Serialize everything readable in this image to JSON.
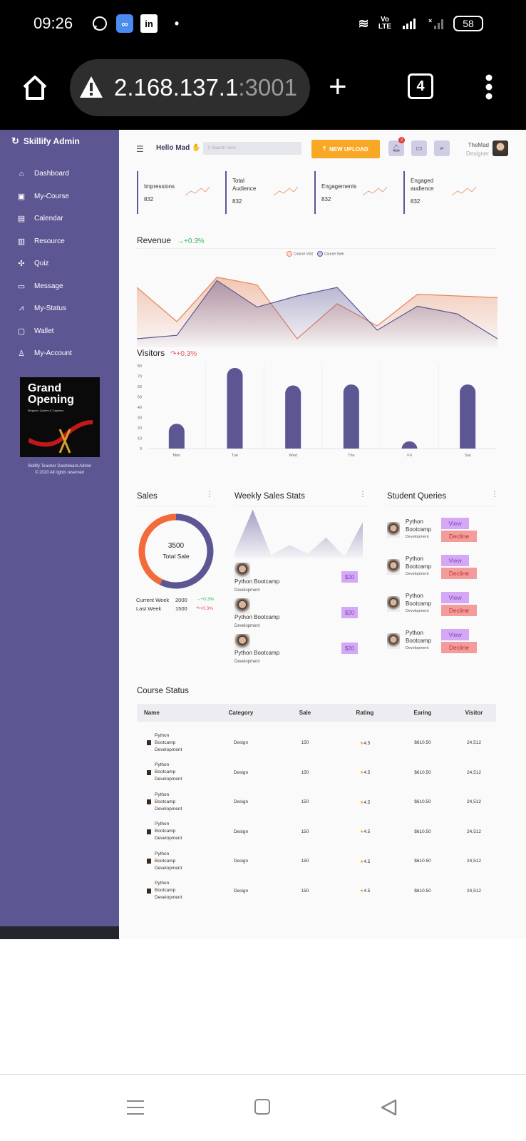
{
  "status_bar": {
    "time": "09:26",
    "battery": "58",
    "network": "Vo LTE",
    "icons": [
      "whatsapp-icon",
      "infinity-app-icon",
      "linkedin-icon",
      "dot-icon",
      "wifi-icon",
      "signal-icon",
      "signal-x-icon",
      "battery-icon"
    ]
  },
  "browser": {
    "url_host": "2.168.137.1",
    "url_port": ":3001",
    "tabs_count": "4",
    "icons": [
      "home-icon",
      "warning-icon",
      "plus-icon",
      "tabs-icon",
      "more-icon"
    ]
  },
  "sidebar": {
    "brand": "Skillify Admin",
    "items": [
      {
        "label": "Dashboard",
        "icon": "home-icon"
      },
      {
        "label": "My-Course",
        "icon": "play-box-icon"
      },
      {
        "label": "Calendar",
        "icon": "calendar-icon"
      },
      {
        "label": "Resource",
        "icon": "book-icon"
      },
      {
        "label": "Quiz",
        "icon": "puzzle-icon"
      },
      {
        "label": "Message",
        "icon": "message-icon"
      },
      {
        "label": "My-Status",
        "icon": "trend-icon"
      },
      {
        "label": "Wallet",
        "icon": "wallet-icon"
      },
      {
        "label": "My-Account",
        "icon": "user-icon"
      }
    ],
    "promo": {
      "title_line1": "Grand",
      "title_line2": "Opening",
      "subtitle": "Blogues, Quotes & Captions"
    },
    "copyright_line1": "Skillify Teacher Dashboard Admin",
    "copyright_line2": "© 2020 All rights reserved"
  },
  "header": {
    "greeting": "Hello Mad ✋",
    "search_placeholder": "Search Here",
    "upload_label": "NEW UPLOAD",
    "notification_count": "2",
    "user_name": "TheMad",
    "user_role": "Designer"
  },
  "stats": [
    {
      "label": "Impressions",
      "value": "832"
    },
    {
      "label": "Total Audience",
      "value": "832"
    },
    {
      "label": "Engagements",
      "value": "832"
    },
    {
      "label": "Engaged audience",
      "value": "832"
    }
  ],
  "revenue": {
    "title": "Revenue",
    "delta": "+0.3%",
    "legend": [
      "Course Visit",
      "Course Sale"
    ]
  },
  "visitors": {
    "title": "Visitors",
    "delta": "+0.3%"
  },
  "chart_data": [
    {
      "type": "area",
      "title": "Revenue",
      "legend_position": "top",
      "series": [
        {
          "name": "Course Visit",
          "color": "#e8855a",
          "values": [
            70,
            30,
            82,
            73,
            10,
            51,
            25,
            62,
            60,
            58
          ]
        },
        {
          "name": "Course Sale",
          "color": "#5c5693",
          "values": [
            10,
            14,
            78,
            47,
            60,
            70,
            20,
            48,
            39,
            10
          ]
        }
      ]
    },
    {
      "type": "bar",
      "title": "Visitors",
      "categories": [
        "Mon",
        "Tue",
        "Wed",
        "Thu",
        "Fri",
        "Sat"
      ],
      "values": [
        24,
        78,
        61,
        62,
        7,
        62
      ],
      "yticks": [
        0,
        10,
        20,
        30,
        40,
        50,
        60,
        70,
        80
      ],
      "ylim": [
        0,
        80
      ],
      "grid": "vertical",
      "color": "#5c5693"
    },
    {
      "type": "pie",
      "title": "Sales",
      "center_value": "3500",
      "center_label": "Total Sale",
      "slices": [
        {
          "label": "Current Week",
          "value": 2000
        },
        {
          "label": "Last Week",
          "value": 1500
        }
      ],
      "colors": [
        "#5c5693",
        "#f36b3b"
      ]
    },
    {
      "type": "area",
      "title": "Weekly Sales Stats",
      "color": "#5c5693",
      "values": [
        10,
        95,
        5,
        25,
        8,
        40,
        2,
        70
      ]
    }
  ],
  "sales": {
    "title": "Sales",
    "total": "3500",
    "total_label": "Total Sale",
    "rows": [
      {
        "label": "Current Week",
        "value": "2000",
        "delta": "+0.3%",
        "dir": "pos"
      },
      {
        "label": "Last Week",
        "value": "1500",
        "delta": "+0.3%",
        "dir": "neg"
      }
    ]
  },
  "weekly": {
    "title": "Weekly Sales Stats",
    "items": [
      {
        "name": "Python Bootcamp",
        "category": "Development",
        "price": "$20"
      },
      {
        "name": "Python Bootcamp",
        "category": "Development",
        "price": "$20"
      },
      {
        "name": "Python Bootcamp",
        "category": "Development",
        "price": "$20"
      }
    ]
  },
  "queries": {
    "title": "Student Queries",
    "view_label": "View",
    "decline_label": "Decline",
    "items": [
      {
        "name_line1": "Python",
        "name_line2": "Bootcamp",
        "category": "Development"
      },
      {
        "name_line1": "Python",
        "name_line2": "Bootcamp",
        "category": "Development"
      },
      {
        "name_line1": "Python",
        "name_line2": "Bootcamp",
        "category": "Development"
      },
      {
        "name_line1": "Python",
        "name_line2": "Bootcamp",
        "category": "Development"
      }
    ]
  },
  "course_status": {
    "title": "Course Status",
    "columns": [
      "Name",
      "Category",
      "Sale",
      "Rating",
      "Earing",
      "Visitor"
    ],
    "rows": [
      {
        "name_line1": "Python",
        "name_line2": "Bootcamp",
        "name_line3": "Development",
        "category": "Design",
        "sale": "150",
        "rating": "4.5",
        "earing": "$610.50",
        "visitor": "24,512"
      },
      {
        "name_line1": "Python",
        "name_line2": "Bootcamp",
        "name_line3": "Development",
        "category": "Design",
        "sale": "150",
        "rating": "4.5",
        "earing": "$610.50",
        "visitor": "24,512"
      },
      {
        "name_line1": "Python",
        "name_line2": "Bootcamp",
        "name_line3": "Development",
        "category": "Design",
        "sale": "150",
        "rating": "4.5",
        "earing": "$610.50",
        "visitor": "24,512"
      },
      {
        "name_line1": "Python",
        "name_line2": "Bootcamp",
        "name_line3": "Development",
        "category": "Design",
        "sale": "150",
        "rating": "4.5",
        "earing": "$610.50",
        "visitor": "24,512"
      },
      {
        "name_line1": "Python",
        "name_line2": "Bootcamp",
        "name_line3": "Development",
        "category": "Design",
        "sale": "150",
        "rating": "4.5",
        "earing": "$610.50",
        "visitor": "24,512"
      },
      {
        "name_line1": "Python",
        "name_line2": "Bootcamp",
        "name_line3": "Development",
        "category": "Design",
        "sale": "150",
        "rating": "4.5",
        "earing": "$610.50",
        "visitor": "24,512"
      }
    ]
  },
  "system_nav": {
    "icons": [
      "recent-apps-icon",
      "home-square-icon",
      "back-icon"
    ]
  }
}
